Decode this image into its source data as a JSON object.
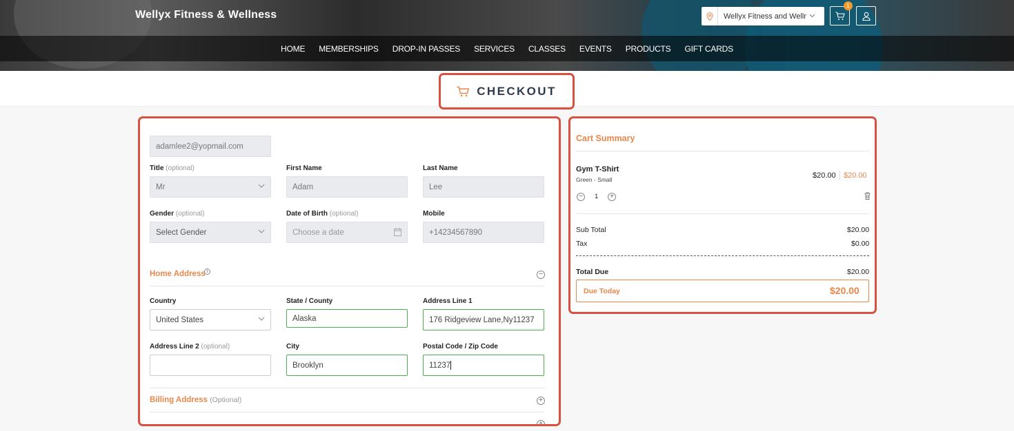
{
  "header": {
    "brand": "Wellyx Fitness & Wellness",
    "location": "Wellyx Fitness and Wellness",
    "cart_count": "1",
    "nav": [
      "HOME",
      "MEMBERSHIPS",
      "DROP-IN PASSES",
      "SERVICES",
      "CLASSES",
      "EVENTS",
      "PRODUCTS",
      "GIFT CARDS"
    ]
  },
  "checkout": {
    "title": "CHECKOUT"
  },
  "form": {
    "email": "adamlee2@yopmail.com",
    "title_label": "Title",
    "title_value": "Mr",
    "first_name_label": "First Name",
    "first_name_value": "Adam",
    "last_name_label": "Last Name",
    "last_name_value": "Lee",
    "gender_label": "Gender",
    "gender_value": "Select Gender",
    "dob_label": "Date of Birth",
    "dob_placeholder": "Choose a date",
    "mobile_label": "Mobile",
    "mobile_value": "+14234567890",
    "optional": "(optional)",
    "home_address": "Home Address",
    "country_label": "Country",
    "country_value": "United States",
    "state_label": "State / County",
    "state_value": "Alaska",
    "address1_label": "Address Line 1",
    "address1_value": "176 Ridgeview Lane,Ny11237",
    "address2_label": "Address Line 2",
    "city_label": "City",
    "city_value": "Brooklyn",
    "postal_label": "Postal Code / Zip Code",
    "postal_value": "11237",
    "billing_address": "Billing Address",
    "billing_optional": "(Optional)"
  },
  "summary": {
    "title": "Cart Summary",
    "item_name": "Gym T-Shirt",
    "item_variant": "Green - Small",
    "item_price": "$20.00",
    "item_total": "$20.00",
    "qty": "1",
    "subtotal_label": "Sub Total",
    "subtotal_value": "$20.00",
    "tax_label": "Tax",
    "tax_value": "$0.00",
    "total_due_label": "Total Due",
    "total_due_value": "$20.00",
    "due_today_label": "Due Today",
    "due_today_value": "$20.00"
  },
  "colors": {
    "accent": "#e8874a",
    "highlight": "#d9503f",
    "valid": "#4caf50"
  }
}
